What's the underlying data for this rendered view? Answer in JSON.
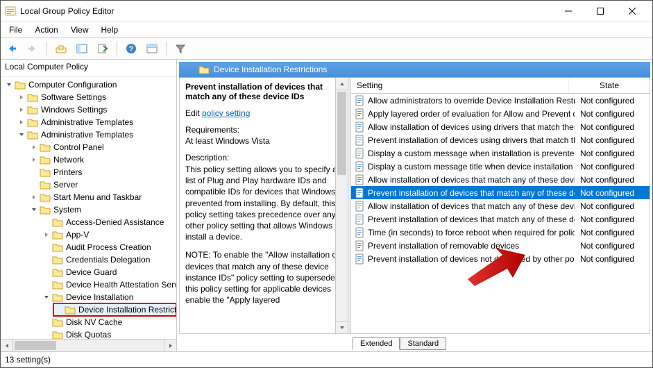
{
  "window": {
    "title": "Local Group Policy Editor"
  },
  "menu": {
    "file": "File",
    "action": "Action",
    "view": "View",
    "help": "Help"
  },
  "tree": {
    "root": "Local Computer Policy",
    "computer_config": "Computer Configuration",
    "software_settings": "Software Settings",
    "windows_settings": "Windows Settings",
    "admin_templates_1": "Administrative Templates",
    "admin_templates_2": "Administrative Templates",
    "control_panel": "Control Panel",
    "network": "Network",
    "printers": "Printers",
    "server": "Server",
    "start_menu": "Start Menu and Taskbar",
    "system": "System",
    "access_denied": "Access-Denied Assistance",
    "app_v": "App-V",
    "audit_process": "Audit Process Creation",
    "creds_delegation": "Credentials Delegation",
    "device_guard": "Device Guard",
    "device_health": "Device Health Attestation Service",
    "device_install": "Device Installation",
    "device_install_restrict": "Device Installation Restrictions",
    "disk_nv": "Disk NV Cache",
    "disk_quotas": "Disk Quotas"
  },
  "right": {
    "pane_title": "Device Installation Restrictions",
    "policy_title": "Prevent installation of devices that match any of these device IDs",
    "edit_label": "Edit",
    "edit_link": "policy setting",
    "req_label": "Requirements:",
    "req_value": "At least Windows Vista",
    "desc_label": "Description:",
    "desc_body": "This policy setting allows you to specify a list of Plug and Play hardware IDs and compatible IDs for devices that Windows is prevented from installing. By default, this policy setting takes precedence over any other policy setting that allows Windows to install a device.",
    "desc_note": "NOTE: To enable the \"Allow installation of devices that match any of these device instance IDs\" policy setting to supersede this policy setting for applicable devices enable the \"Apply layered"
  },
  "columns": {
    "setting": "Setting",
    "state": "State"
  },
  "settings": [
    {
      "name": "Allow administrators to override Device Installation Restricti...",
      "state": "Not configured"
    },
    {
      "name": "Apply layered order of evaluation for Allow and Prevent devi...",
      "state": "Not configured"
    },
    {
      "name": "Allow installation of devices using drivers that match these ...",
      "state": "Not configured"
    },
    {
      "name": "Prevent installation of devices using drivers that match thes...",
      "state": "Not configured"
    },
    {
      "name": "Display a custom message when installation is prevented by...",
      "state": "Not configured"
    },
    {
      "name": "Display a custom message title when device installation is pr...",
      "state": "Not configured"
    },
    {
      "name": "Allow installation of devices that match any of these device ...",
      "state": "Not configured"
    },
    {
      "name": "Prevent installation of devices that match any of these devic...",
      "state": "Not configured"
    },
    {
      "name": "Allow installation of devices that match any of these device ...",
      "state": "Not configured"
    },
    {
      "name": "Prevent installation of devices that match any of these devic...",
      "state": "Not configured"
    },
    {
      "name": "Time (in seconds) to force reboot when required for policy c...",
      "state": "Not configured"
    },
    {
      "name": "Prevent installation of removable devices",
      "state": "Not configured"
    },
    {
      "name": "Prevent installation of devices not described by other policy ...",
      "state": "Not configured"
    }
  ],
  "tabs": {
    "extended": "Extended",
    "standard": "Standard"
  },
  "status": "13 setting(s)",
  "selected_row_index": 7
}
